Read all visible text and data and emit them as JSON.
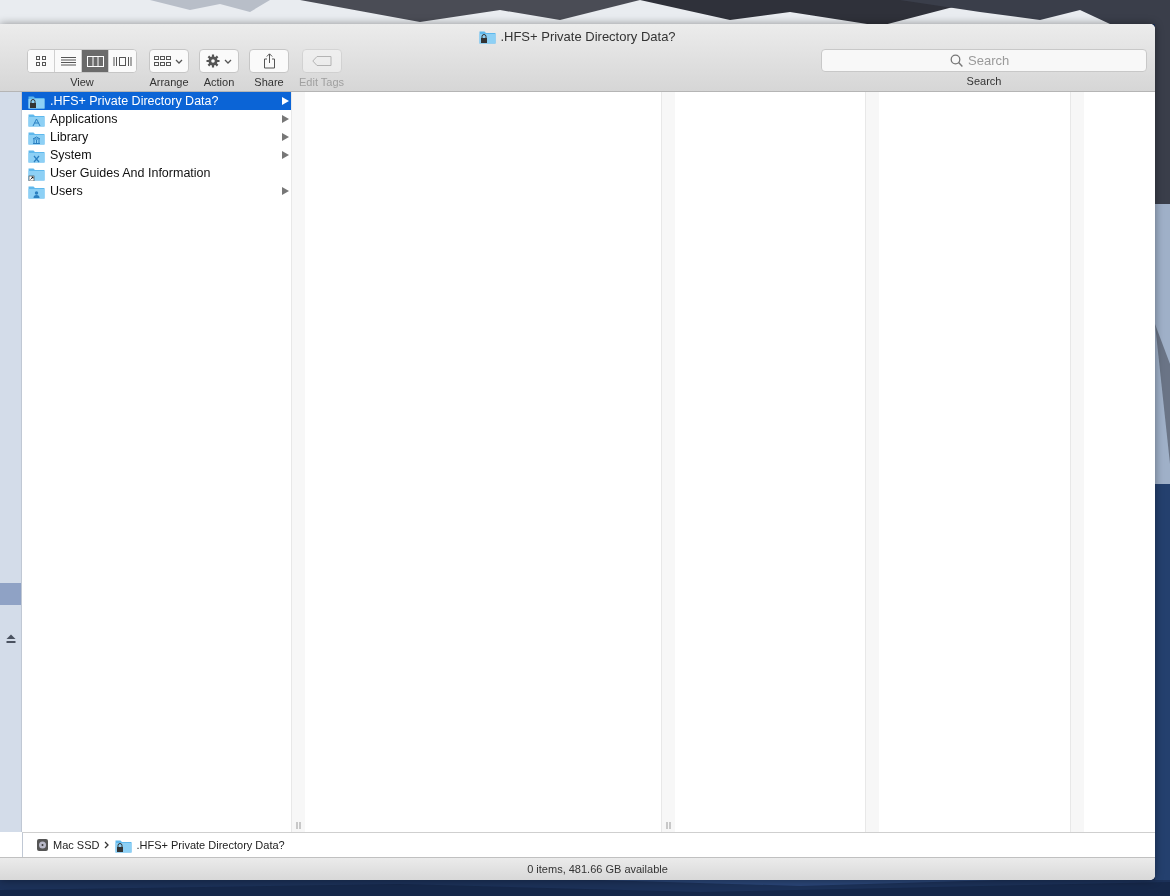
{
  "window": {
    "title": ".HFS+ Private Directory Data?"
  },
  "toolbar": {
    "view": {
      "label": "View",
      "segments": [
        {
          "kind": "icons",
          "selected": false
        },
        {
          "kind": "list",
          "selected": false
        },
        {
          "kind": "columns",
          "selected": true
        },
        {
          "kind": "gallery",
          "selected": false
        }
      ]
    },
    "buttons": [
      {
        "kind": "arrange",
        "label": "Arrange",
        "disabled": false
      },
      {
        "kind": "action",
        "label": "Action",
        "disabled": false
      },
      {
        "kind": "share",
        "label": "Share",
        "disabled": false
      },
      {
        "kind": "tags",
        "label": "Edit Tags",
        "disabled": true
      }
    ],
    "search": {
      "placeholder": "Search",
      "label": "Search"
    }
  },
  "sidebar": {
    "rows": [
      {
        "selected": true,
        "ejectable": false
      },
      {
        "selected": false,
        "ejectable": true
      }
    ]
  },
  "columns": [
    {
      "items": [
        {
          "name": ".HFS+ Private Directory Data?",
          "kind": "locked",
          "selected": true,
          "has_children": true
        },
        {
          "name": "Applications",
          "kind": "apps",
          "selected": false,
          "has_children": true
        },
        {
          "name": "Library",
          "kind": "library",
          "selected": false,
          "has_children": true
        },
        {
          "name": "System",
          "kind": "system",
          "selected": false,
          "has_children": true
        },
        {
          "name": "User Guides And Information",
          "kind": "alias",
          "selected": false,
          "has_children": false
        },
        {
          "name": "Users",
          "kind": "user",
          "selected": false,
          "has_children": true
        }
      ],
      "grip": true
    },
    {
      "grip": true
    },
    {
      "grip": false
    },
    {
      "grip": false
    },
    {}
  ],
  "path_bar": [
    {
      "name": "Mac SSD",
      "kind": "disk"
    },
    {
      "name": ".HFS+ Private Directory Data?",
      "kind": "locked"
    }
  ],
  "status_bar": "0 items, 481.66 GB available"
}
